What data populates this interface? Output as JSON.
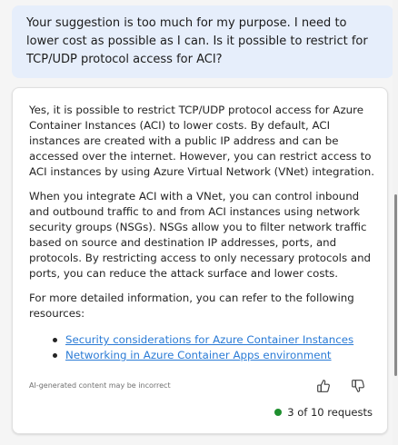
{
  "user_message": {
    "text": "Your suggestion is too much for my purpose. I need to lower cost as possible as I can. Is it possible to restrict for TCP/UDP protocol access for ACI?"
  },
  "assistant_message": {
    "paragraphs": [
      "Yes, it is possible to restrict TCP/UDP protocol access for Azure Container Instances (ACI) to lower costs. By default, ACI instances are created with a public IP address and can be accessed over the internet. However, you can restrict access to ACI instances by using Azure Virtual Network (VNet) integration.",
      "When you integrate ACI with a VNet, you can control inbound and outbound traffic to and from ACI instances using network security groups (NSGs). NSGs allow you to filter network traffic based on source and destination IP addresses, ports, and protocols. By restricting access to only necessary protocols and ports, you can reduce the attack surface and lower costs.",
      "For more detailed information, you can refer to the following resources:"
    ],
    "links": [
      "Security considerations for Azure Container Instances",
      "Networking in Azure Container Apps environment"
    ],
    "disclaimer": "AI-generated content may be incorrect",
    "request_count": "3 of 10 requests"
  },
  "icons": {
    "thumbs_up": "thumbs-up-icon",
    "thumbs_down": "thumbs-down-icon",
    "status": "status-dot-icon"
  },
  "colors": {
    "user_bubble": "#e6eefb",
    "link": "#2a7bd6",
    "status_dot": "#1e8f2e"
  }
}
